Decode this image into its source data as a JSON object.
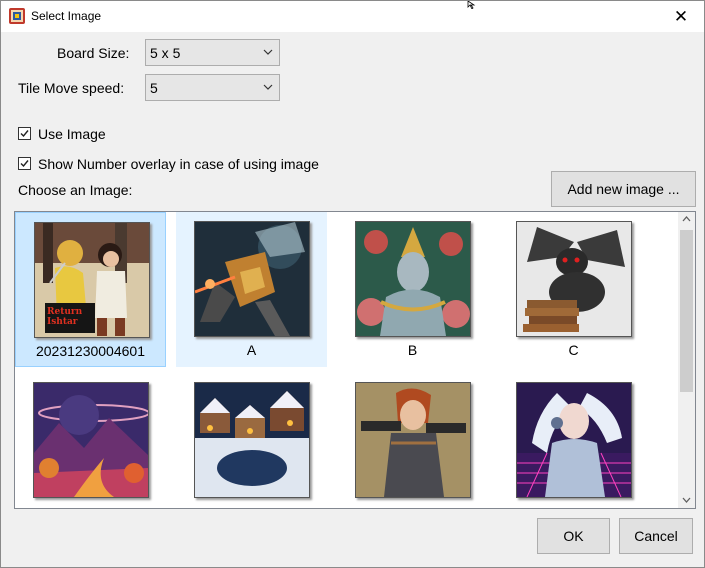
{
  "window": {
    "title": "Select Image",
    "close_glyph": "✕"
  },
  "board_size": {
    "label": "Board Size:",
    "value": "5 x 5"
  },
  "tile_speed": {
    "label": "Tile Move speed:",
    "value": "5"
  },
  "use_image": {
    "label": "Use Image",
    "checked": true
  },
  "show_number": {
    "label": "Show Number overlay in case of using image",
    "checked": true
  },
  "choose_label": "Choose an Image:",
  "add_button": "Add new image ...",
  "images": [
    {
      "caption": "20231230004601",
      "state": "selected"
    },
    {
      "caption": "A",
      "state": "hover"
    },
    {
      "caption": "B",
      "state": ""
    },
    {
      "caption": "C",
      "state": ""
    },
    {
      "caption": "",
      "state": ""
    },
    {
      "caption": "",
      "state": ""
    },
    {
      "caption": "",
      "state": ""
    },
    {
      "caption": "",
      "state": ""
    }
  ],
  "thumbnail_art": {
    "0": {
      "logo": "Return of Ishtar"
    }
  },
  "ok_button": "OK",
  "cancel_button": "Cancel",
  "icons": {
    "app": "puzzle-app-icon",
    "close": "close-icon",
    "chevron": "chevron-down-icon",
    "check": "checkmark-icon",
    "scroll_up": "scroll-up-icon",
    "scroll_down": "scroll-down-icon"
  }
}
